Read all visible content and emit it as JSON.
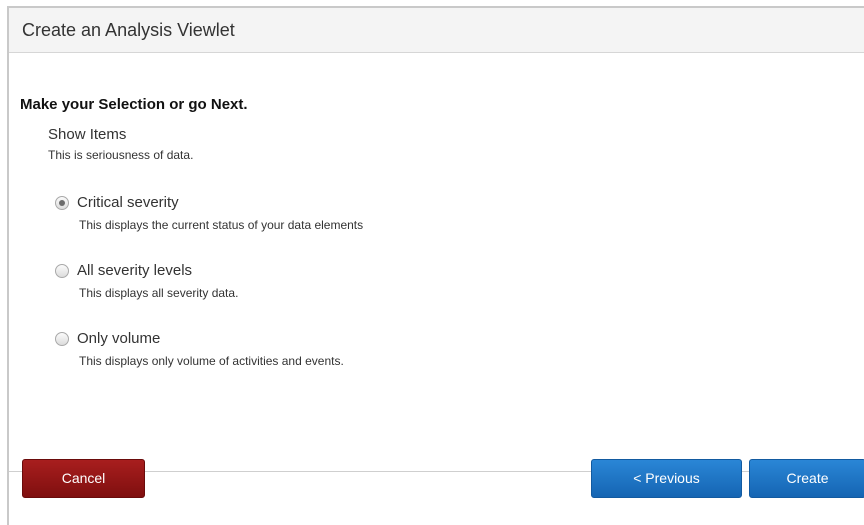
{
  "dialog": {
    "title": "Create an Analysis Viewlet",
    "prompt": "Make your Selection or go Next."
  },
  "group": {
    "title": "Show Items",
    "description": "This is seriousness of data."
  },
  "options": [
    {
      "label": "Critical severity",
      "description": "This displays the current status of your data elements",
      "selected": true
    },
    {
      "label": "All severity levels",
      "description": "This displays all severity data.",
      "selected": false
    },
    {
      "label": "Only volume",
      "description": "This displays only volume of activities and events.",
      "selected": false
    }
  ],
  "buttons": {
    "cancel": "Cancel",
    "previous": "< Previous",
    "create": "Create"
  },
  "colors": {
    "cancel": "#8f1515",
    "primary": "#1b73c2"
  }
}
